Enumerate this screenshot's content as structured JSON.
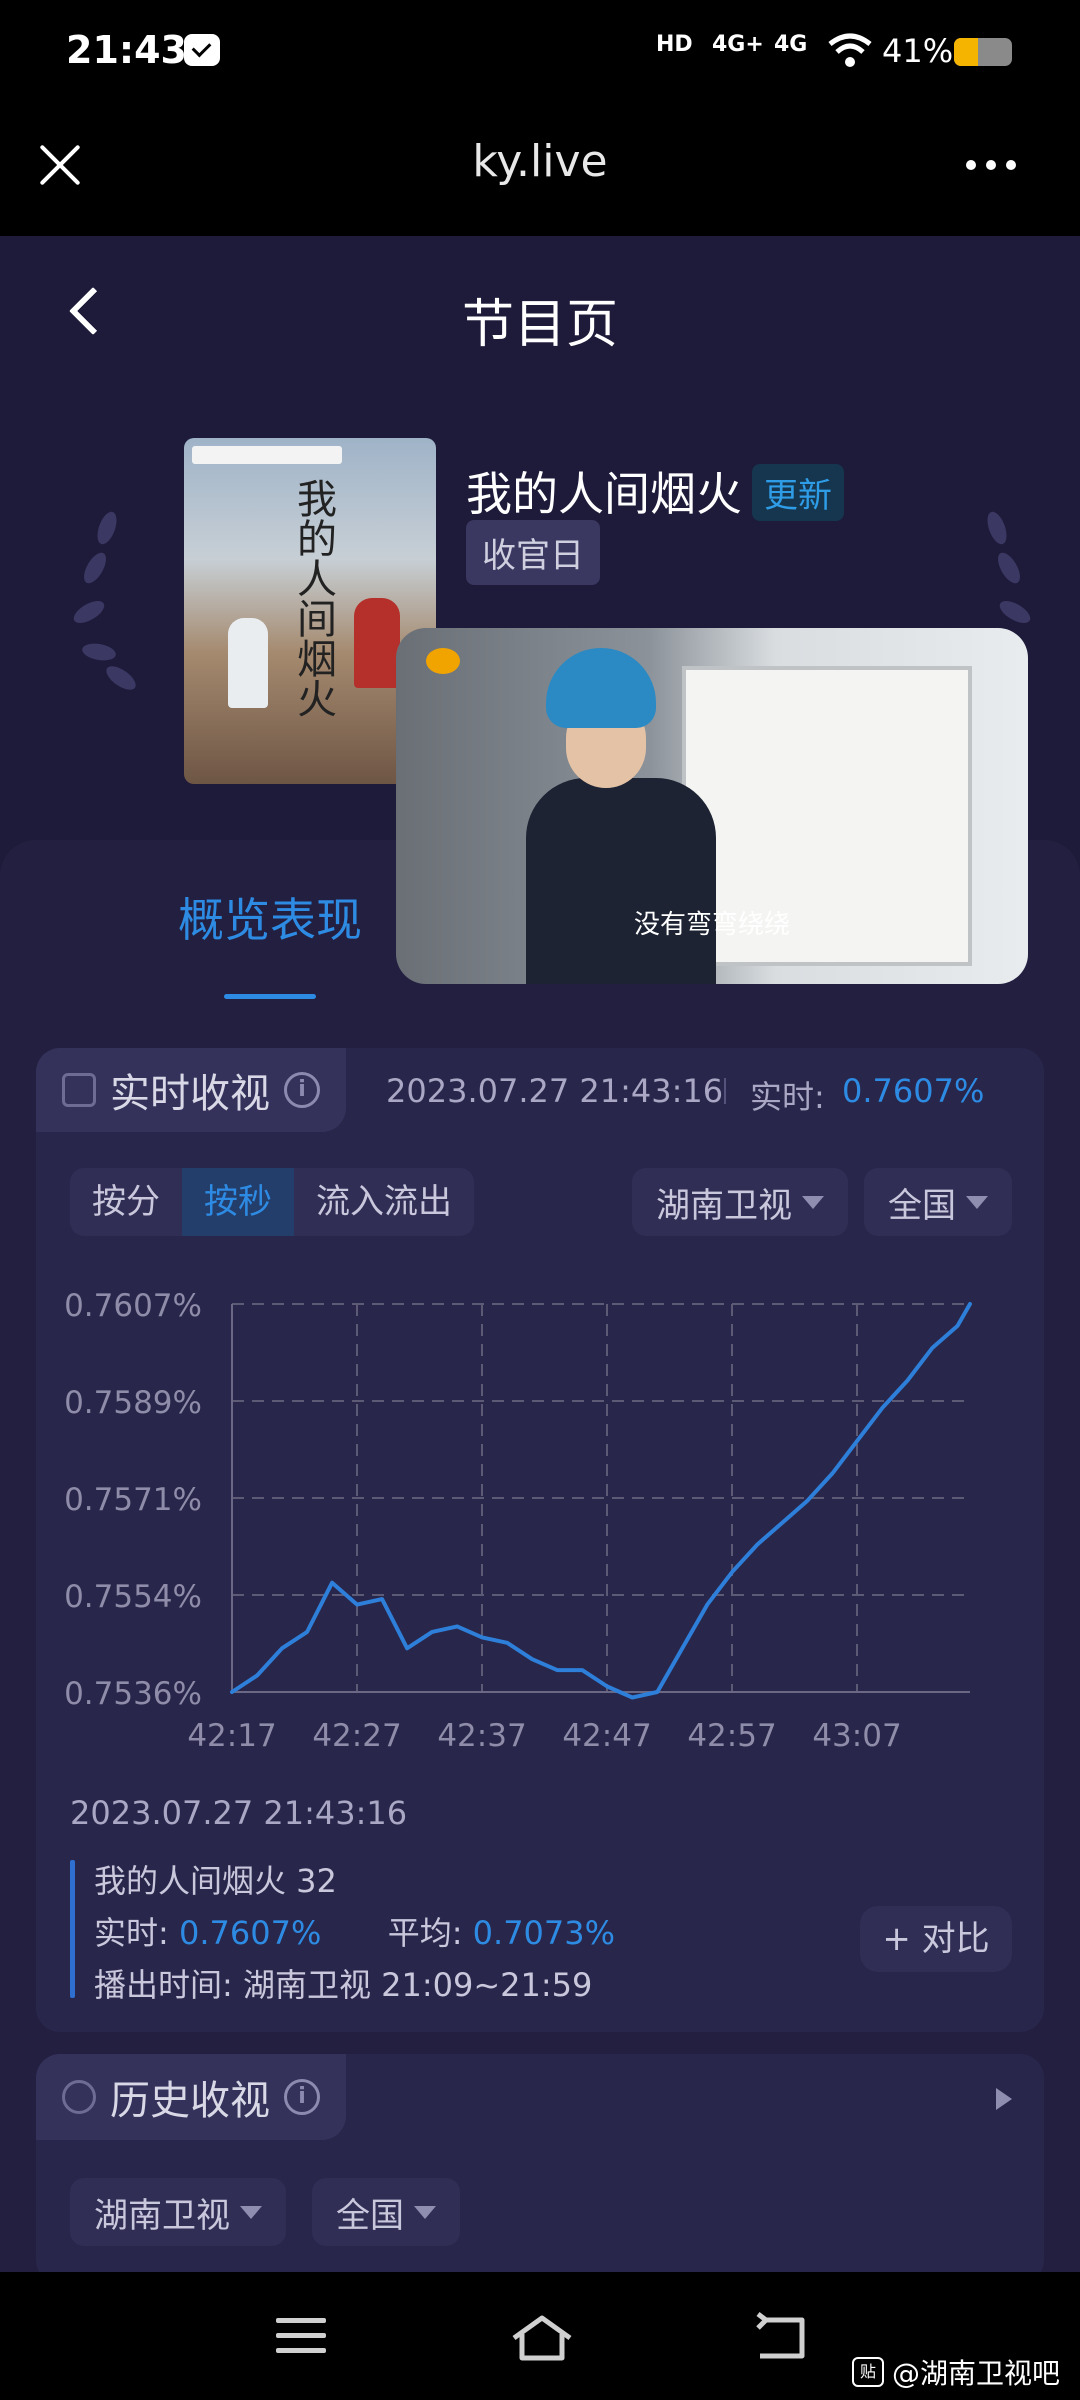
{
  "status_bar": {
    "time": "21:43",
    "signal_labels": [
      "HD",
      "4G+",
      "4G"
    ],
    "battery_percent_text": "41%",
    "battery_level": 0.41,
    "battery_color": "#f5b400"
  },
  "browser": {
    "url": "ky.live",
    "close_icon": "close-icon",
    "more_icon": "more-dots-icon"
  },
  "header": {
    "title": "节目页",
    "back_icon": "back-chevron-icon"
  },
  "program": {
    "poster_title": "我的人间烟火",
    "title": "我的人间烟火",
    "badge": "更新",
    "episode_tag": "收官日",
    "video_subtitle": "没有弯弯绕绕"
  },
  "tabs": {
    "active": "概览表现"
  },
  "realtime": {
    "title": "实时收视",
    "timestamp": "2023.07.27 21:43:16",
    "label": "实时:",
    "value": "0.7607%",
    "segments": [
      "按分",
      "按秒",
      "流入流出"
    ],
    "active_segment": "按秒",
    "channel": "湖南卫视",
    "region": "全国"
  },
  "chart_data": {
    "type": "line",
    "title": "",
    "xlabel": "",
    "ylabel": "",
    "x_ticks": [
      "42:17",
      "42:27",
      "42:37",
      "42:47",
      "42:57",
      "43:07"
    ],
    "y_ticks": [
      "0.7536%",
      "0.7554%",
      "0.7571%",
      "0.7589%",
      "0.7607%"
    ],
    "ylim": [
      0.7536,
      0.7607
    ],
    "xlim_seconds": [
      0,
      59
    ],
    "grid": true,
    "series": [
      {
        "name": "",
        "color": "#2e7fd9",
        "x": [
          0,
          2,
          4,
          6,
          8,
          10,
          12,
          14,
          16,
          18,
          20,
          22,
          24,
          26,
          28,
          30,
          32,
          34,
          36,
          38,
          40,
          42,
          44,
          46,
          48,
          50,
          52,
          54,
          56,
          58,
          59
        ],
        "y": [
          0.7536,
          0.7539,
          0.7544,
          0.7547,
          0.7556,
          0.7552,
          0.7553,
          0.7544,
          0.7547,
          0.7548,
          0.7546,
          0.7545,
          0.7542,
          0.754,
          0.754,
          0.7537,
          0.7535,
          0.7536,
          0.7544,
          0.7552,
          0.7558,
          0.7563,
          0.7567,
          0.7571,
          0.7576,
          0.7582,
          0.7588,
          0.7593,
          0.7599,
          0.7603,
          0.7607
        ]
      }
    ]
  },
  "detail": {
    "date": "2023.07.27 21:43:16",
    "program_line": "我的人间烟火 32",
    "realtime_label": "实时:",
    "realtime_value": "0.7607%",
    "avg_label": "平均:",
    "avg_value": "0.7073%",
    "airtime": "播出时间: 湖南卫视 21:09~21:59",
    "compare_button": "+ 对比"
  },
  "history": {
    "title": "历史收视",
    "channel": "湖南卫视",
    "region": "全国"
  },
  "watermark": "@湖南卫视吧",
  "watermark_icon_text": "贴"
}
